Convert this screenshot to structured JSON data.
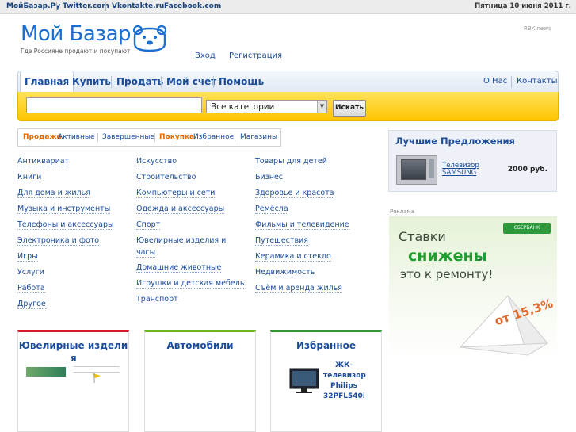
{
  "topbar": {
    "links": [
      "МойБазар.Ру",
      "Twitter.com",
      "Vkontakte.ru",
      "Facebook.com"
    ],
    "date": "Пятница 10 июня 2011 г."
  },
  "logo": {
    "name": "Мой Базар",
    "tagline": "Где Россияне продают и покупают"
  },
  "rbk": "RBK.news",
  "auth": {
    "login": "Вход",
    "register": "Регистрация"
  },
  "nav": {
    "items": [
      "Главная",
      "Купить",
      "Продать",
      "Мой счет",
      "Помощь"
    ],
    "right": [
      "О Нас",
      "Контакты"
    ]
  },
  "search": {
    "value": "",
    "category": "Все категории",
    "button": "Искать"
  },
  "filter": {
    "sale_label": "Продажа",
    "active": "Активные",
    "finished": "Завершенные",
    "buy_label": "Покупка",
    "favorites": "Избранное",
    "shops": "Магазины"
  },
  "categories": {
    "col1": [
      "Антиквариат",
      "Книги",
      "Для дома и жилья",
      "Музыка и инструменты",
      "Телефоны и аксессуары",
      "Электроника и фото",
      "Игры",
      "Услуги",
      "Работа",
      "Другое"
    ],
    "col2": [
      "Искусство",
      "Строительство",
      "Компьютеры и сети",
      "Одежда и аксессуары",
      "Спорт",
      "Ювелирные изделия и",
      "часы",
      "Домашние животные",
      "Игрушки и детская мебель",
      "Транспорт"
    ],
    "col3": [
      "Товары для детей",
      "Бизнес",
      "Здоровье и красота",
      "Ремёсла",
      "Фильмы и телевидение",
      "Путешествия",
      "Керамика и стекло",
      "Недвижимость",
      "Съём и аренда жилья"
    ]
  },
  "boxes": {
    "jewelry": "Ювелирные издели",
    "jewelry_cont": "я",
    "cars": "Автомобили",
    "favorites": "Избранное",
    "fav_item": [
      "ЖК-",
      "телевизор",
      "Philips",
      "32PFL5405H"
    ]
  },
  "best": {
    "title": "Лучшие Предложения",
    "item": "Телевизор SAMSUNG",
    "price": "2000 руб."
  },
  "ad": {
    "label": "Реклама",
    "bank": "СБЕРБАНК",
    "line1": "Ставки",
    "line2": "снижены",
    "line3": "это к ремонту!",
    "pct": "от 15,3%"
  },
  "colors": {
    "accent": "#1a4c9a",
    "search_band": "#ffc400",
    "sale_label": "#e06a00"
  }
}
